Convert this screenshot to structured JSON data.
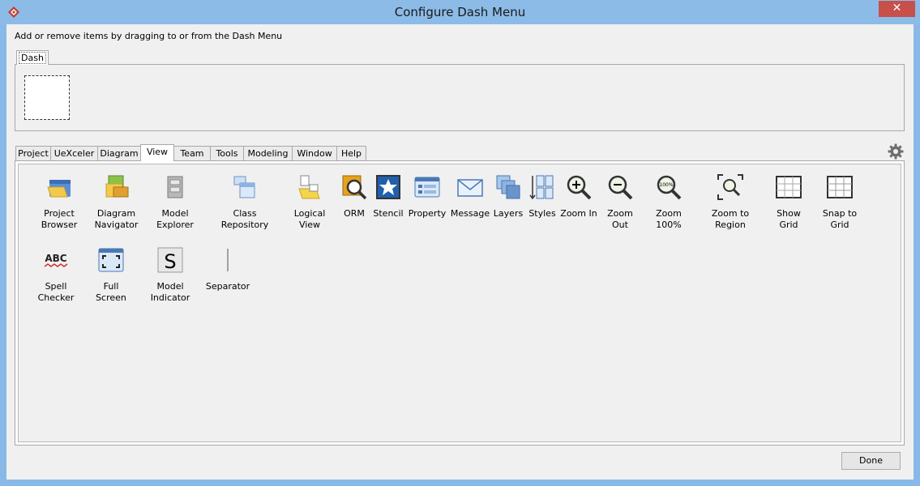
{
  "window": {
    "title": "Configure Dash Menu",
    "close_glyph": "✕"
  },
  "instructions": "Add or remove items by dragging to or from the Dash Menu",
  "dash_tab": "Dash",
  "tabs": [
    "Project",
    "UeXceler",
    "Diagram",
    "View",
    "Team",
    "Tools",
    "Modeling",
    "Window",
    "Help"
  ],
  "active_tab": "View",
  "items_row1": [
    "Project Browser",
    "Diagram\nNavigator",
    "Model Explorer",
    "Class Repository",
    "Logical View",
    "ORM",
    "Stencil",
    "Property",
    "Message",
    "Layers",
    "Styles",
    "Zoom In",
    "Zoom Out",
    "Zoom 100%",
    "Zoom to Region",
    "Show Grid",
    "Snap to Grid"
  ],
  "items_row2": [
    "Spell Checker",
    "Full Screen",
    "Model Indicator",
    "Separator"
  ],
  "icons": {
    "spell_text": "ABC",
    "model_indicator_letter": "S",
    "zoom_100_text": "100%"
  },
  "done_label": "Done"
}
